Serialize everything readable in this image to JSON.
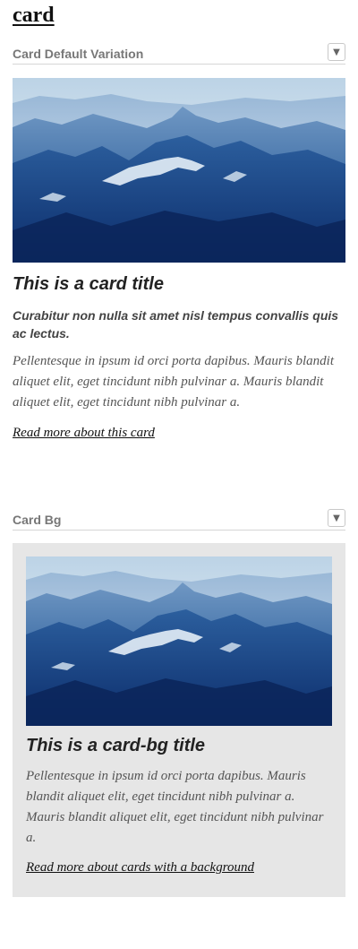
{
  "page": {
    "title": "card"
  },
  "variations": [
    {
      "label": "Card Default Variation",
      "toggle_icon": "▼",
      "card": {
        "title": "This is a card title",
        "subtitle": "Curabitur non nulla sit amet nisl tempus convallis quis ac lectus.",
        "body": "Pellentesque in ipsum id orci porta dapibus. Mauris blandit aliquet elit, eget tincidunt nibh pulvinar a. Mauris blandit aliquet elit, eget tincidunt nibh pulvinar a.",
        "link": "Read more about this card",
        "image_icon": "mountain-landscape-image"
      }
    },
    {
      "label": "Card Bg",
      "toggle_icon": "▼",
      "card": {
        "title": "This is a card-bg title",
        "body": "Pellentesque in ipsum id orci porta dapibus. Mauris blandit aliquet elit, eget tincidunt nibh pulvinar a. Mauris blandit aliquet elit, eget tincidunt nibh pulvinar a.",
        "link": "Read more about cards with a background",
        "image_icon": "mountain-landscape-image",
        "background_color": "#e6e6e6"
      }
    }
  ]
}
